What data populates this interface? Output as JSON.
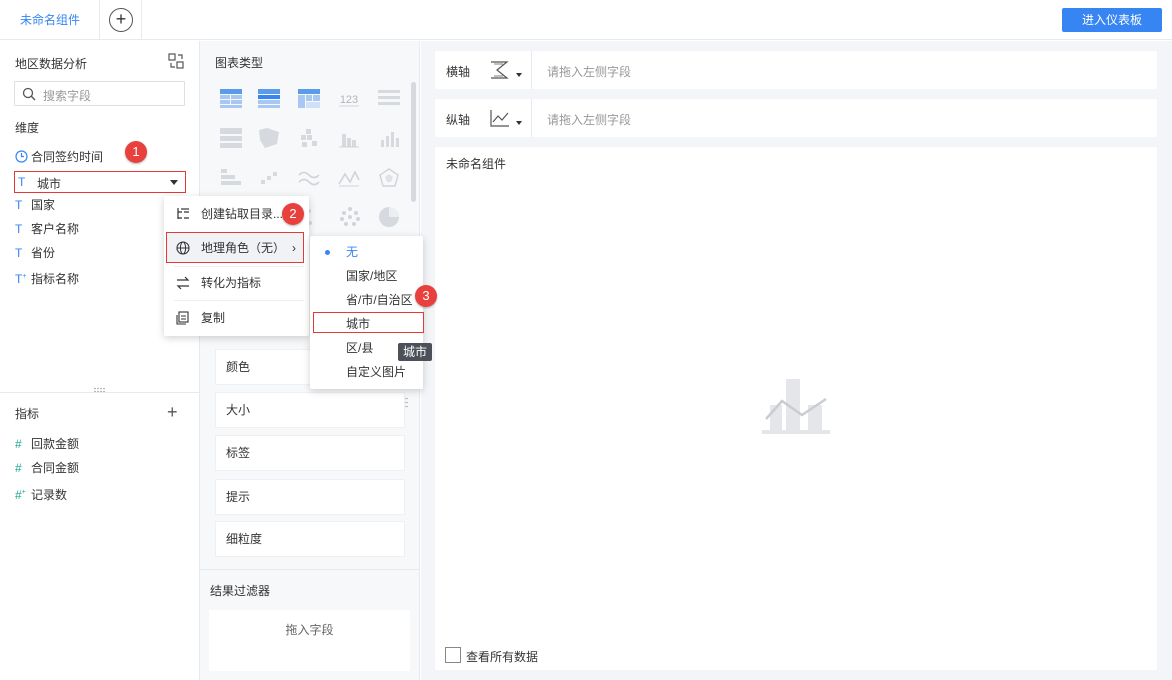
{
  "top": {
    "tab_label": "未命名组件",
    "enter_dashboard": "进入仪表板"
  },
  "left": {
    "title": "地区数据分析",
    "search_placeholder": "搜索字段",
    "dimension_title": "维度",
    "dimensions": [
      {
        "icon": "clock-icon",
        "label": "合同签约时间"
      },
      {
        "icon": "text-type-icon",
        "label": "城市"
      },
      {
        "icon": "text-type-icon",
        "label": "国家"
      },
      {
        "icon": "text-type-icon",
        "label": "客户名称"
      },
      {
        "icon": "text-type-icon",
        "label": "省份"
      },
      {
        "icon": "text-type-icon",
        "label": "指标名称"
      }
    ],
    "measure_title": "指标",
    "measures": [
      {
        "icon": "hash-icon",
        "label": "回款金额"
      },
      {
        "icon": "hash-icon",
        "label": "合同金额"
      },
      {
        "icon": "hash-icon",
        "label": "记录数"
      }
    ]
  },
  "mid": {
    "chart_type_title": "图表类型",
    "properties": [
      "颜色",
      "大小",
      "标签",
      "提示",
      "细粒度"
    ],
    "filter_title": "结果过滤器",
    "drop_hint": "拖入字段"
  },
  "right": {
    "x_axis_label": "横轴",
    "y_axis_label": "纵轴",
    "axis_placeholder": "请拖入左侧字段",
    "component_title": "未命名组件",
    "view_all_data": "查看所有数据"
  },
  "context_menu": {
    "items": [
      "创建钻取目录...",
      "地理角色（无）",
      "转化为指标",
      "复制"
    ]
  },
  "submenu": {
    "options": [
      "无",
      "国家/地区",
      "省/市/自治区",
      "城市",
      "区/县",
      "自定义图片"
    ]
  },
  "tooltip": "城市",
  "badges": [
    "1",
    "2",
    "3"
  ],
  "colors": {
    "accent": "#3685f2",
    "highlight": "#e53935",
    "badge": "#e8403c"
  }
}
